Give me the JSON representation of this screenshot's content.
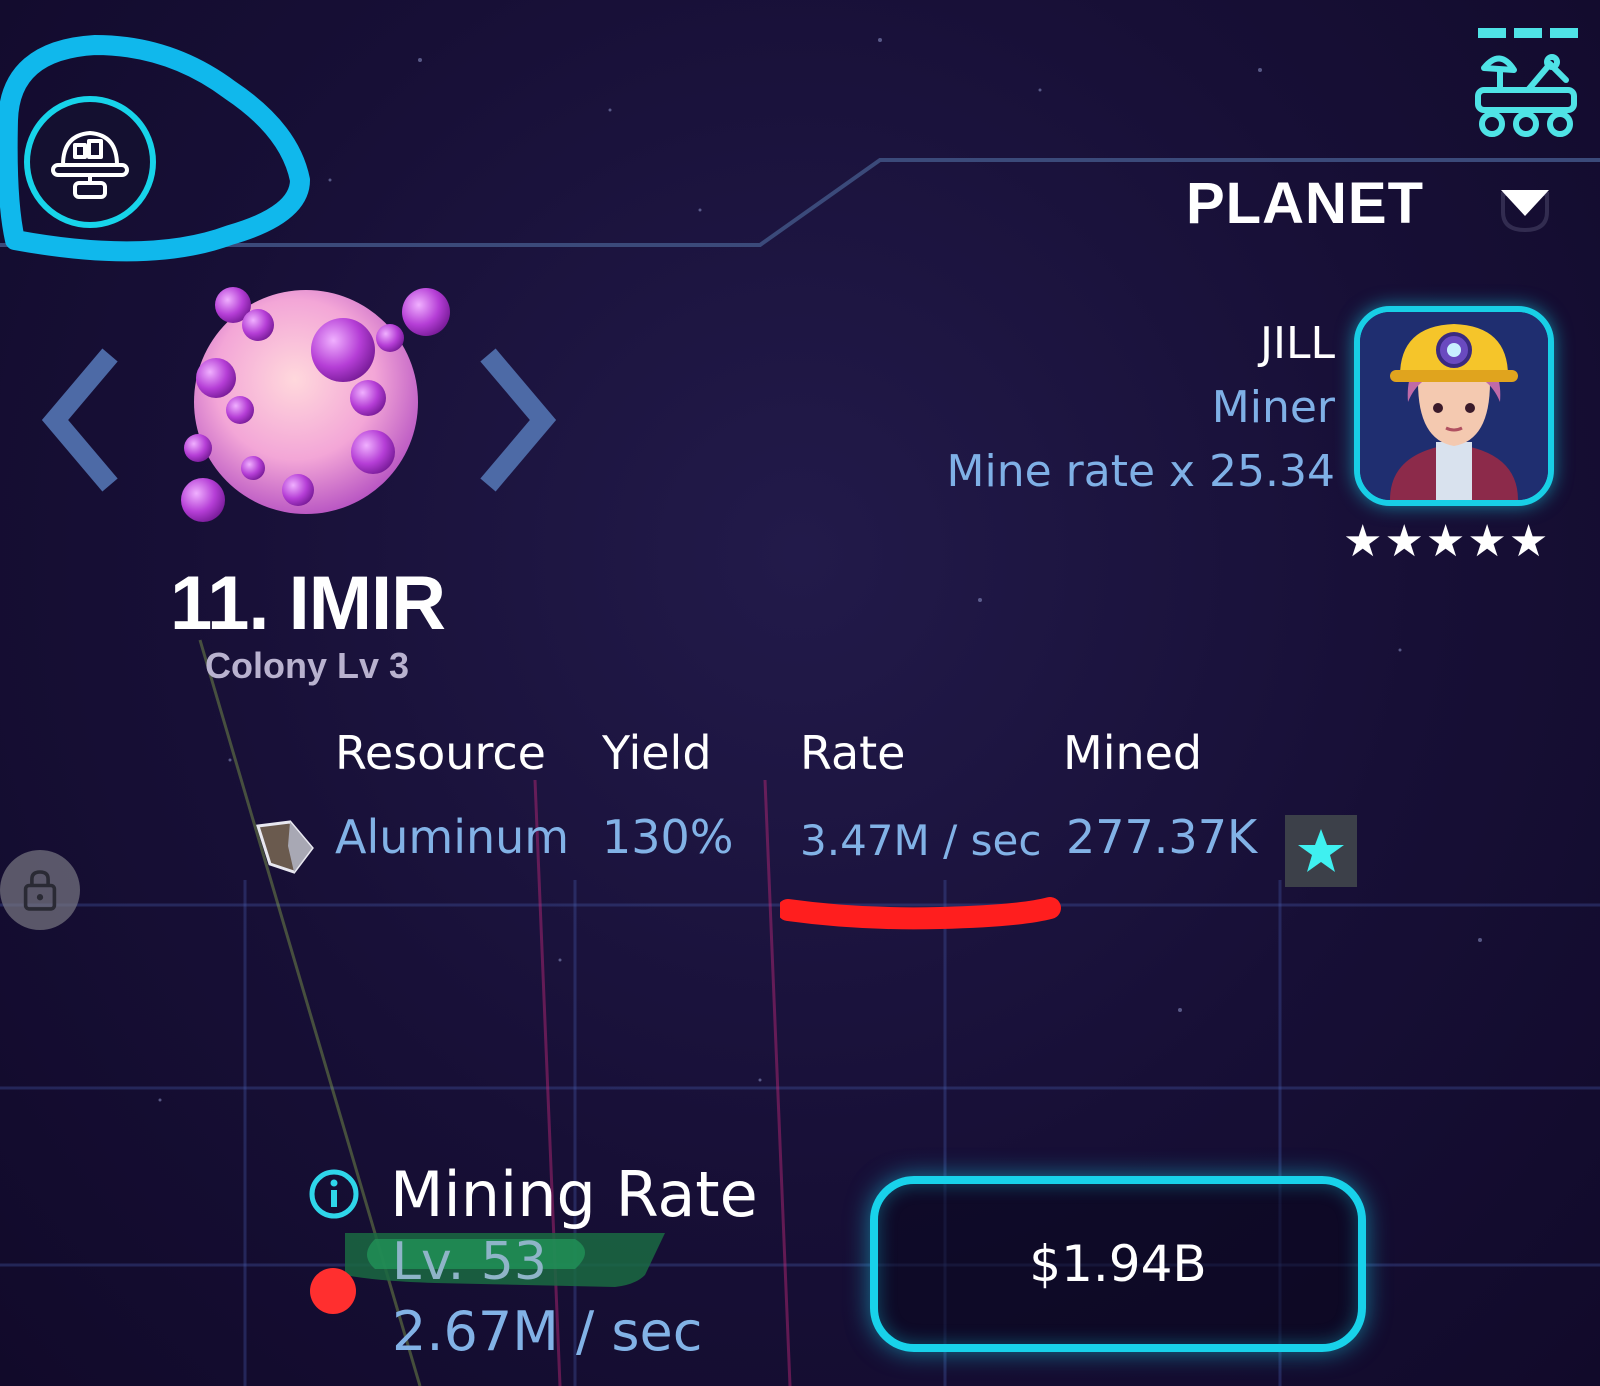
{
  "header": {
    "section_label": "PLANET",
    "icons": [
      "colony-icon",
      "rover-icon",
      "dropdown-icon"
    ]
  },
  "planet": {
    "name": "11. IMIR",
    "colony_level": "Colony Lv 3"
  },
  "manager": {
    "name": "JILL",
    "role": "Miner",
    "bonus": "Mine rate x 25.34",
    "stars": [
      "★",
      "★",
      "★",
      "★",
      "★"
    ]
  },
  "resources": {
    "headers": {
      "resource": "Resource",
      "yield": "Yield",
      "rate": "Rate",
      "mined": "Mined"
    },
    "row": {
      "name": "Aluminum",
      "yield": "130%",
      "rate": "3.47M / sec",
      "mined": "277.37K"
    }
  },
  "mining_rate": {
    "title": "Mining Rate",
    "level": "Lv. 53",
    "value": "2.67M / sec",
    "upgrade_cost": "$1.94B"
  },
  "colors": {
    "accent": "#18d2ea",
    "text_blue": "#82b2e6",
    "annotation_red": "#ff2f2f",
    "annotation_green": "#1f7a4a"
  }
}
